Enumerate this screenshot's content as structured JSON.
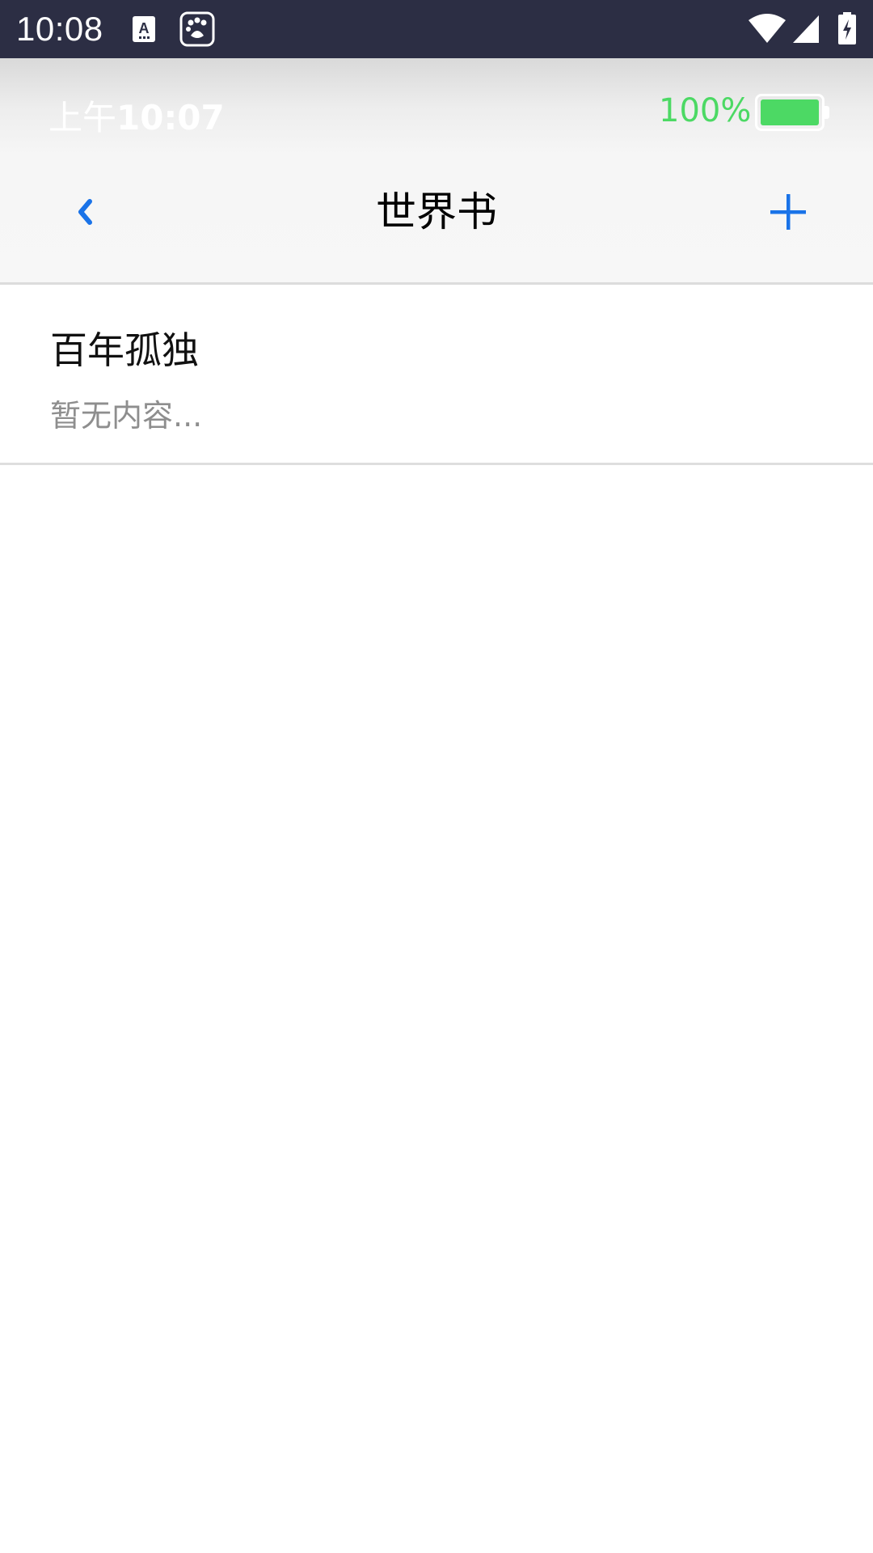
{
  "system_bar": {
    "time": "10:08",
    "icons": [
      "keyboard-a-icon",
      "baidu-paw-icon",
      "wifi-icon",
      "cell-signal-icon",
      "battery-charging-icon"
    ]
  },
  "inner_status": {
    "time_prefix": "上午",
    "time": "10:07",
    "battery_percent": "100%",
    "battery_level": 1.0,
    "battery_color": "#4cd964"
  },
  "nav": {
    "title": "世界书",
    "back_icon": "chevron-left-icon",
    "add_icon": "plus-icon",
    "accent_color": "#1a73e8"
  },
  "list": {
    "items": [
      {
        "title": "百年孤独",
        "subtitle": "暂无内容..."
      }
    ]
  }
}
